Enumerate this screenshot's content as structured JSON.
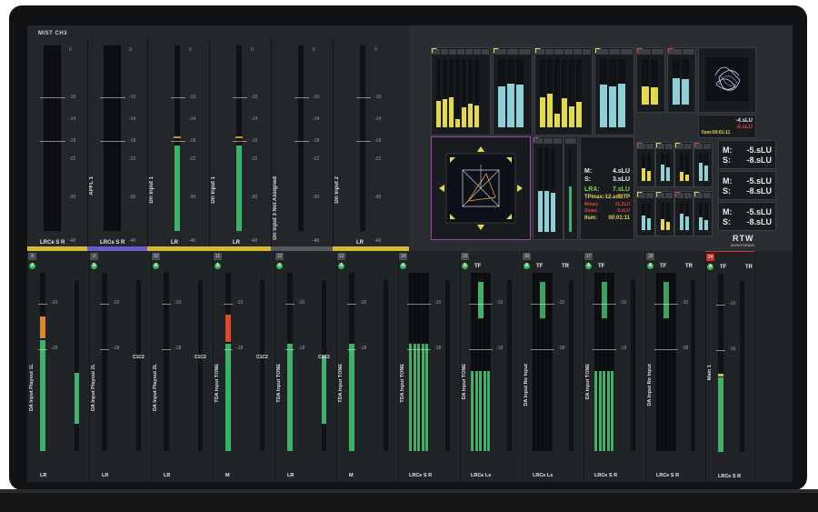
{
  "top_section": {
    "label": "MIST CH3"
  },
  "ticks": {
    "t0": "0",
    "t10": "-10",
    "t14": "-14",
    "t18": "-18",
    "t22": "-22",
    "t30": "-30",
    "t40": "-40"
  },
  "top_strips": [
    {
      "side_label": "",
      "bottom_label": "LRCe S R",
      "color": "#d8b830",
      "level": 0
    },
    {
      "side_label": "APFL 1",
      "bottom_label": "LRCe S R",
      "color": "#6b5ac8",
      "level": 0
    },
    {
      "side_label": "Dri Input 1",
      "bottom_label": "LR",
      "color": "#d8b830",
      "level": 0.46
    },
    {
      "side_label": "Dri Input 1",
      "bottom_label": "LR",
      "color": "#d8b830",
      "level": 0.46
    },
    {
      "side_label": "Dri Input 3 Not Assigned",
      "bottom_label": "",
      "color": "#555a60",
      "level": 0
    },
    {
      "side_label": "Dri Input 2",
      "bottom_label": "LR",
      "color": "#d8b830",
      "level": 0
    }
  ],
  "loudness": {
    "m1": "M:",
    "m1v": "4.sLU",
    "s1": "S:",
    "s1v": "3.sLU",
    "lra": "LRA:",
    "lrav": "7.sLU",
    "tp": "TPmax:",
    "tpv": "-12.sdBTP",
    "mmax": "Mmax:",
    "mmaxv": "11.2LU",
    "smax": "Smax:",
    "smaxv": "9.sLU",
    "itime": "Ilsm:",
    "itimev": "00:01:11"
  },
  "mini_panels": [
    {
      "m": "M:",
      "mv": "-5.sLU",
      "s": "S:",
      "sv": "-8.sLU"
    },
    {
      "m": "M:",
      "mv": "-5.sLU",
      "s": "S:",
      "sv": "-8.sLU"
    },
    {
      "m": "M:",
      "mv": "-5.sLU",
      "s": "S:",
      "sv": "-8.sLU"
    }
  ],
  "top_right_readout": {
    "a": "-4.sLU",
    "b": "-6.sLU",
    "t": "Ilsm:00:01:11"
  },
  "logo": {
    "text": "RTW",
    "sub": "MONITORING"
  },
  "bottom_strips": [
    {
      "num": "8",
      "label": "DA Input Playout 1L",
      "bottom": "LR",
      "tf": "",
      "tr": "",
      "c1c2": "",
      "level": 0.62,
      "peak": "#d88a2a",
      "accent": "none",
      "level2": 0.3
    },
    {
      "num": "9",
      "label": "DA Input Playout 2L",
      "bottom": "LR",
      "tf": "",
      "tr": "",
      "c1c2": "C1C2",
      "level": 0,
      "peak": "",
      "accent": "none",
      "level2": 0
    },
    {
      "num": "10",
      "label": "DA Input Playout 2L",
      "bottom": "LR",
      "tf": "",
      "tr": "",
      "c1c2": "C1C2",
      "level": 0,
      "peak": "",
      "accent": "none",
      "level2": 0
    },
    {
      "num": "11",
      "label": "TDA Input TONE",
      "bottom": "M",
      "tf": "",
      "tr": "",
      "c1c2": "C1C2",
      "level": 0.6,
      "peak": "#d84a2a",
      "accent": "none",
      "level2": 0
    },
    {
      "num": "12",
      "label": "TDA Input TONE",
      "bottom": "LR",
      "tf": "",
      "tr": "",
      "c1c2": "C1C2",
      "level": 0.6,
      "peak": "",
      "accent": "none",
      "level2": 0.4
    },
    {
      "num": "13",
      "label": "TDA Input TONE",
      "bottom": "M",
      "tf": "",
      "tr": "",
      "c1c2": "",
      "level": 0.6,
      "peak": "",
      "accent": "none",
      "level2": 0
    },
    {
      "num": "14",
      "label": "TDA Input TONE",
      "bottom": "LRCe S R",
      "tf": "",
      "tr": "",
      "c1c2": "",
      "level": 0.6,
      "peak": "",
      "accent": "multi",
      "level2": 0
    },
    {
      "num": "15",
      "label": "DA Input TONE",
      "bottom": "LRCe Ls",
      "tf": "TF",
      "tr": "",
      "c1c2": "",
      "level": 0.45,
      "peak": "",
      "accent": "multi",
      "level2": 0
    },
    {
      "num": "16",
      "label": "DA Input No Input",
      "bottom": "LRCe Ls",
      "tf": "TF",
      "tr": "TR",
      "c1c2": "",
      "level": 0,
      "peak": "",
      "accent": "multi",
      "level2": 0
    },
    {
      "num": "17",
      "label": "DA Input TONE",
      "bottom": "LRCe S R",
      "tf": "TF",
      "tr": "",
      "c1c2": "",
      "level": 0.45,
      "peak": "",
      "accent": "multi",
      "level2": 0
    },
    {
      "num": "18",
      "label": "DA Input No Input",
      "bottom": "LRCe S R",
      "tf": "TF",
      "tr": "TR",
      "c1c2": "",
      "level": 0,
      "peak": "",
      "accent": "multi",
      "level2": 0
    },
    {
      "num": "24",
      "label": "Main 1",
      "bottom": "LRCe S R",
      "tf": "TF",
      "tr": "TR",
      "c1c2": "",
      "level": 0.42,
      "peak": "#d8b830",
      "accent": "red",
      "level2": 0
    }
  ]
}
